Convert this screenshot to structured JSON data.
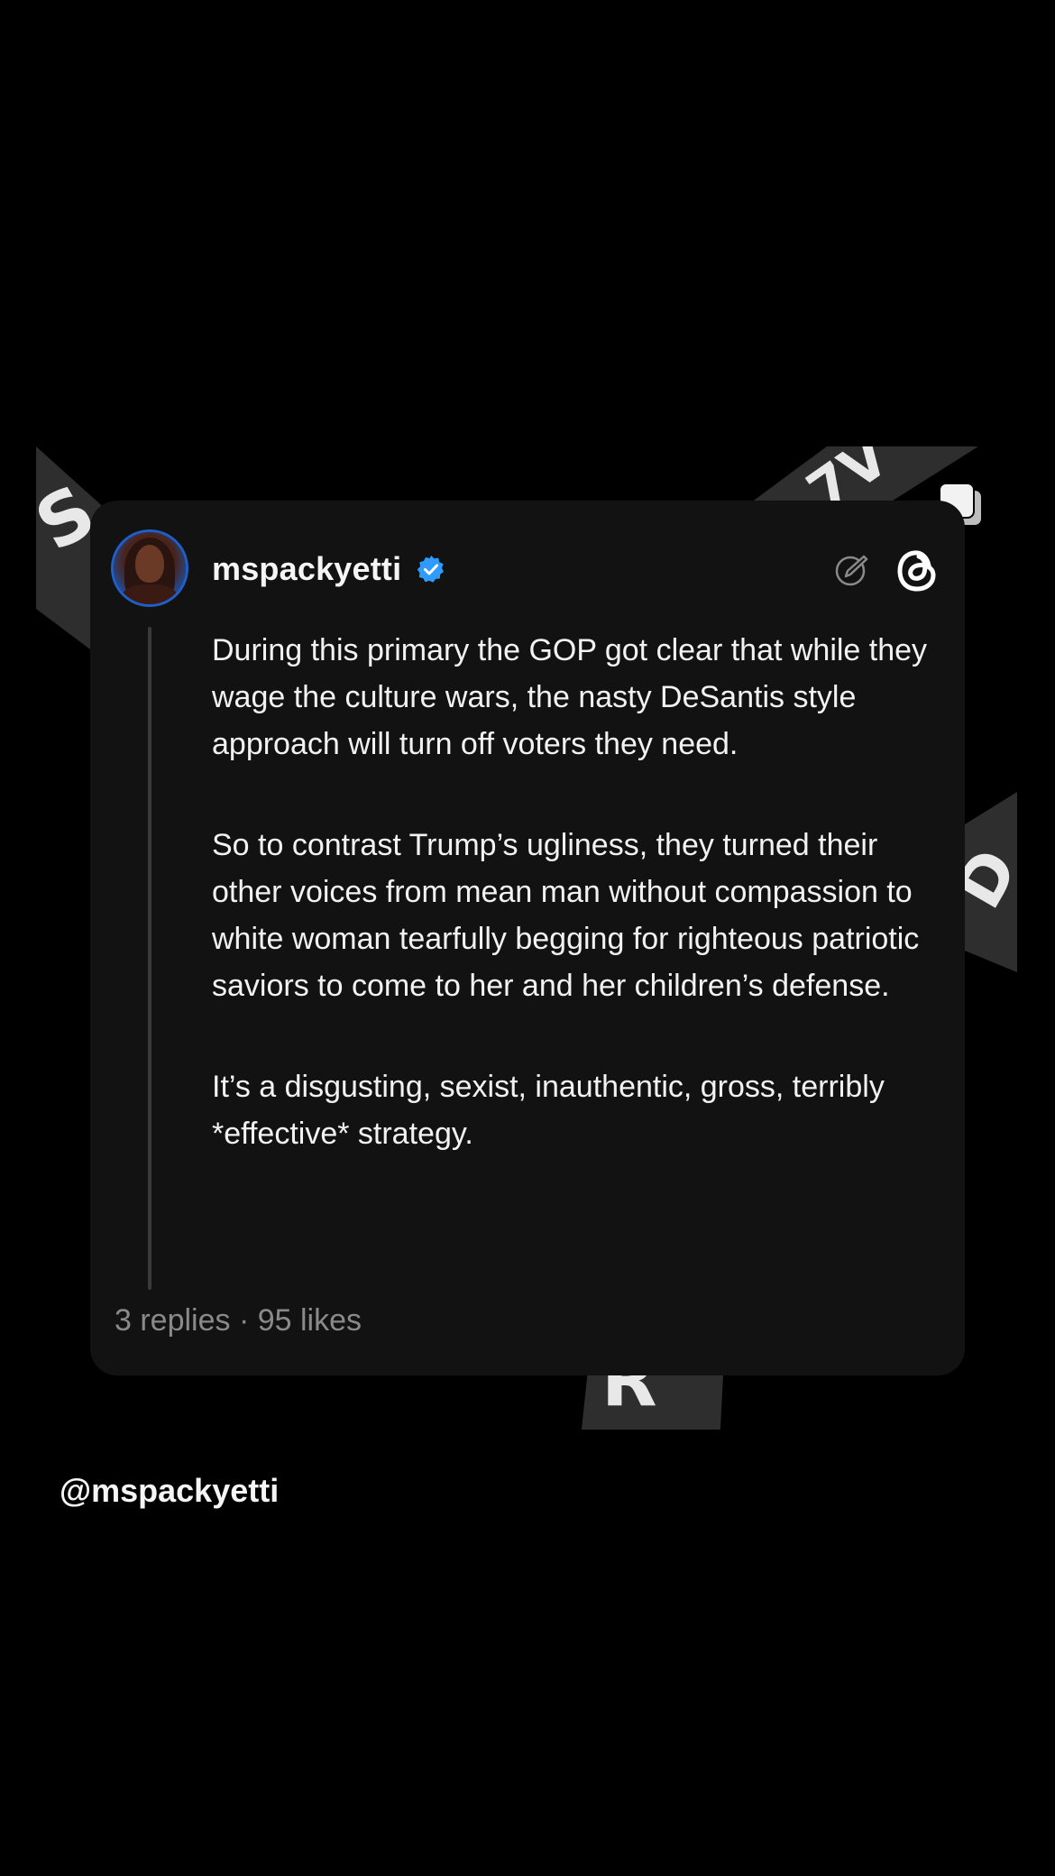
{
  "post": {
    "username": "mspackyetti",
    "verified": true,
    "paragraphs": [
      "During this primary the GOP got clear that while they wage the culture wars, the nasty DeSantis style approach will turn off voters they need.",
      "So to contrast Trump’s ugliness, they turned their other voices from mean man without compassion to white woman tearfully begging for righteous patriotic saviors to come to  her and her children’s defense.",
      "It’s a disgusting, sexist, inauthentic, gross, terribly *effective* strategy."
    ],
    "replies": "3 replies",
    "separator": " · ",
    "likes": "95 likes"
  },
  "footer": {
    "handle": "@mspackyetti"
  },
  "icons": {
    "stack": "stacked-pages-icon",
    "verified": "verified-badge-icon",
    "compose": "compose-icon",
    "threads": "threads-logo-icon"
  },
  "colors": {
    "background": "#000000",
    "card": "#121212",
    "verified": "#2f9bff",
    "muted_text": "#8a8a8a",
    "ribbon": "#2e2e2e"
  }
}
